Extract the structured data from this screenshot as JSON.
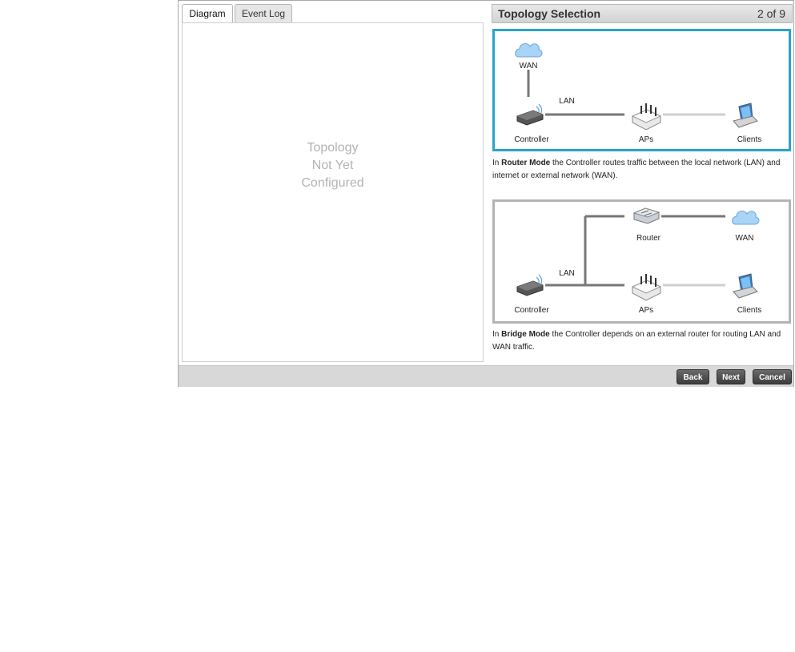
{
  "tabs": {
    "diagram": "Diagram",
    "event_log": "Event Log"
  },
  "diagram": {
    "empty_line1": "Topology",
    "empty_line2": "Not Yet",
    "empty_line3": "Configured"
  },
  "wizard": {
    "title": "Topology Selection",
    "step": "2 of 9"
  },
  "router_mode": {
    "labels": {
      "wan": "WAN",
      "lan": "LAN",
      "controller": "Controller",
      "aps": "APs",
      "clients": "Clients"
    },
    "desc_prefix": "In ",
    "desc_bold": "Router Mode",
    "desc_rest": " the Controller routes traffic between the local network (LAN) and internet or external network (WAN)."
  },
  "bridge_mode": {
    "labels": {
      "router": "Router",
      "wan": "WAN",
      "lan": "LAN",
      "controller": "Controller",
      "aps": "APs",
      "clients": "Clients"
    },
    "desc_prefix": "In ",
    "desc_bold": "Bridge Mode",
    "desc_rest": " the Controller depends on an external router for routing LAN and WAN traffic."
  },
  "buttons": {
    "back": "Back",
    "next": "Next",
    "cancel": "Cancel"
  },
  "colors": {
    "selected_border": "#2aa3c8",
    "unselected_border": "#b4b4b4",
    "cloud": "#a9d4f5"
  },
  "icons": [
    "cloud-icon",
    "controller-icon",
    "access-point-icon",
    "laptop-icon",
    "router-icon"
  ]
}
